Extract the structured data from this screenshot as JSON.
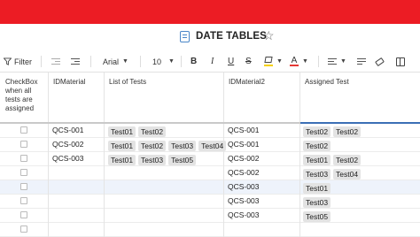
{
  "document": {
    "title": "DATE TABLES"
  },
  "toolbar": {
    "filter_label": "Filter",
    "font_name": "Arial",
    "font_size": "10"
  },
  "columns": [
    "CheckBox when all tests are assigned",
    "IDMaterial",
    "List of Tests",
    "IDMaterial2",
    "Assigned Test"
  ],
  "rows": [
    {
      "idmaterial": "QCS-001",
      "tests": [
        "Test01",
        "Test02"
      ],
      "idmaterial2": "QCS-001",
      "assigned": [
        "Test02",
        "Test02"
      ]
    },
    {
      "idmaterial": "QCS-002",
      "tests": [
        "Test01",
        "Test02",
        "Test03",
        "Test04"
      ],
      "idmaterial2": "QCS-001",
      "assigned": [
        "Test02"
      ]
    },
    {
      "idmaterial": "QCS-003",
      "tests": [
        "Test01",
        "Test03",
        "Test05"
      ],
      "idmaterial2": "QCS-002",
      "assigned": [
        "Test01",
        "Test02"
      ]
    },
    {
      "idmaterial": "",
      "tests": [],
      "idmaterial2": "QCS-002",
      "assigned": [
        "Test03",
        "Test04"
      ]
    },
    {
      "idmaterial": "",
      "tests": [],
      "idmaterial2": "QCS-003",
      "assigned": [
        "Test01"
      ]
    },
    {
      "idmaterial": "",
      "tests": [],
      "idmaterial2": "QCS-003",
      "assigned": [
        "Test03"
      ]
    },
    {
      "idmaterial": "",
      "tests": [],
      "idmaterial2": "QCS-003",
      "assigned": [
        "Test05"
      ]
    },
    {
      "idmaterial": "",
      "tests": [],
      "idmaterial2": "",
      "assigned": []
    }
  ],
  "colors": {
    "brand_bar": "#ec1c24",
    "accent": "#3b6fb5",
    "chip": "#e3e3e3",
    "selected_row": "#eef3fb"
  }
}
